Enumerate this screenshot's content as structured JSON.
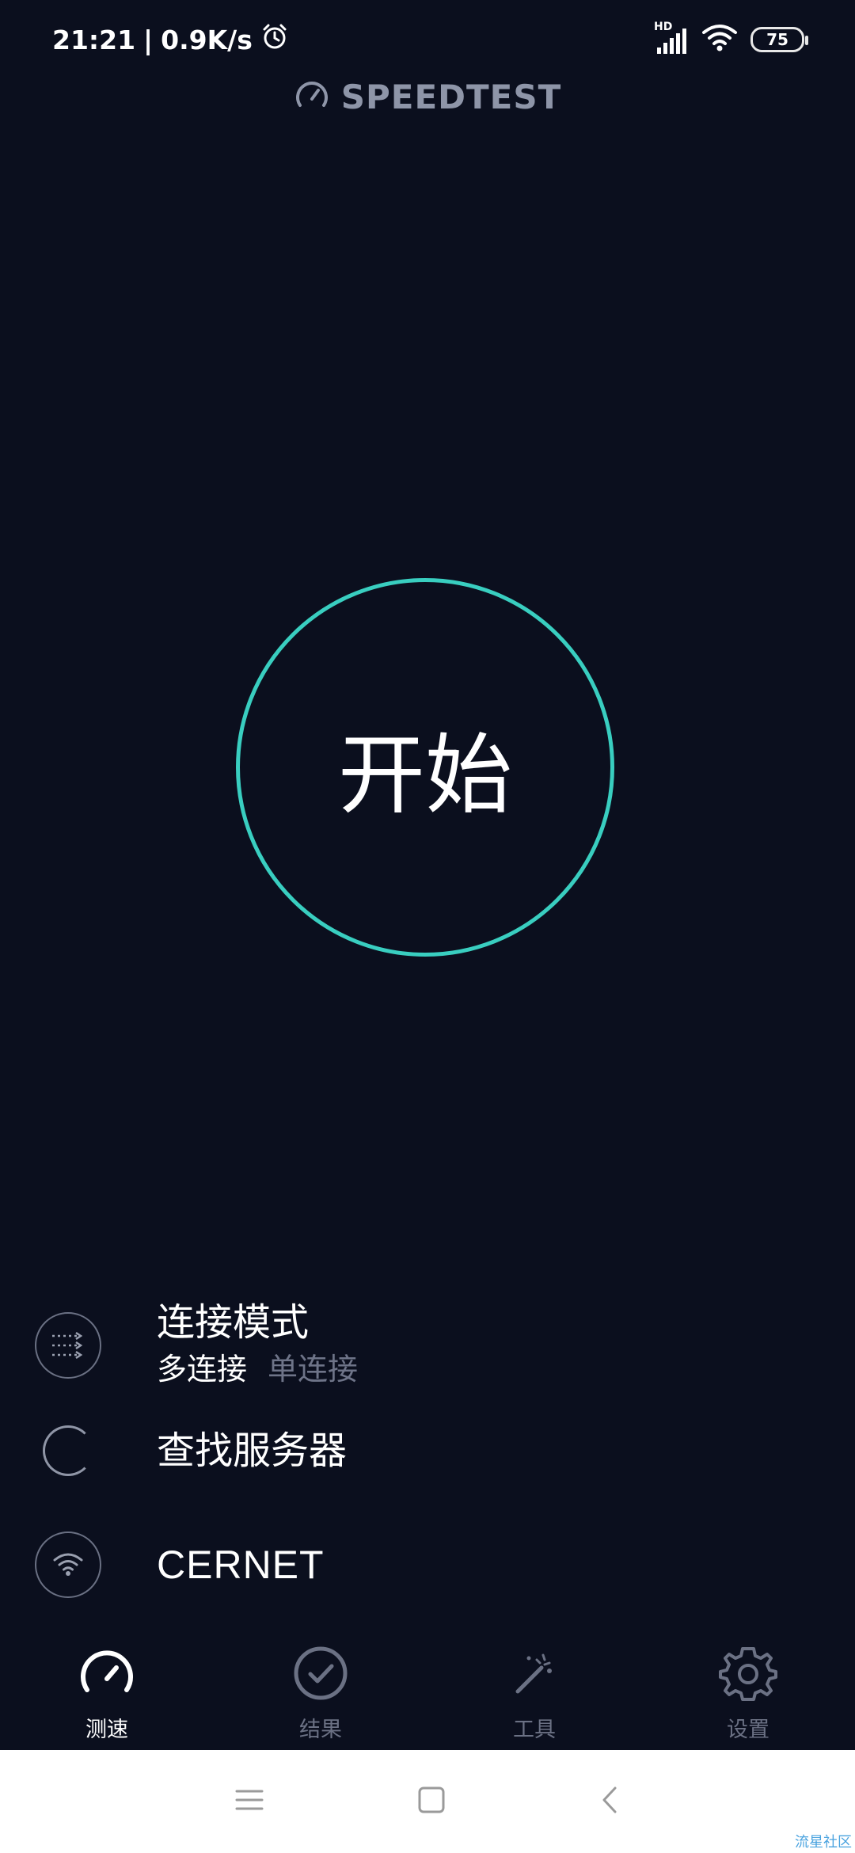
{
  "status_bar": {
    "time": "21:21",
    "separator": "|",
    "net_speed": "0.9K/s",
    "network_badge": "HD",
    "battery": "75",
    "icons": [
      "alarm-icon",
      "signal-icon",
      "wifi-icon",
      "battery-icon"
    ]
  },
  "brand": {
    "logo_icon": "speedometer-icon",
    "name": "SPEEDTEST"
  },
  "start_button": {
    "label": "开始",
    "ring_color": "#39cec0"
  },
  "connection_mode": {
    "title": "连接模式",
    "options": [
      "多连接",
      "单连接"
    ],
    "selected": "多连接"
  },
  "server": {
    "label": "查找服务器"
  },
  "network": {
    "name": "CERNET"
  },
  "tabs": [
    {
      "label": "测速",
      "icon": "speedometer-icon",
      "active": true
    },
    {
      "label": "结果",
      "icon": "check-circle-icon",
      "active": false
    },
    {
      "label": "工具",
      "icon": "magic-wand-icon",
      "active": false
    },
    {
      "label": "设置",
      "icon": "gear-icon",
      "active": false
    }
  ],
  "system_nav": {
    "buttons": [
      "menu-icon",
      "home-icon",
      "back-icon"
    ]
  },
  "watermark": "流星社区",
  "colors": {
    "background": "#0b0f1e",
    "accent": "#39cec0",
    "muted": "#6e7488"
  }
}
